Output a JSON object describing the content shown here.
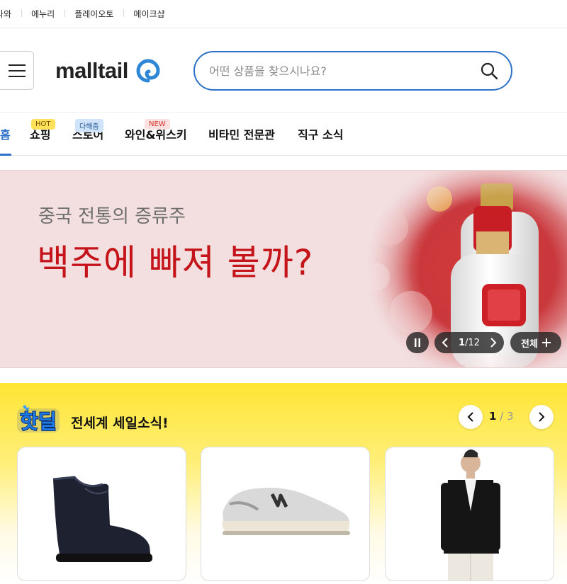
{
  "top_links": [
    "나와",
    "에누리",
    "플레이오토",
    "메이크샵"
  ],
  "logo": {
    "text": "malltail"
  },
  "search": {
    "placeholder": "어떤 상품을 찾으시나요?"
  },
  "nav": {
    "items": [
      {
        "label": "홈",
        "active": true
      },
      {
        "label": "쇼핑",
        "badge": "HOT"
      },
      {
        "label": "스토어",
        "badge": "다해줌"
      },
      {
        "label": "와인&위스키",
        "badge": "NEW"
      },
      {
        "label": "비타민 전문관"
      },
      {
        "label": "직구 소식"
      }
    ]
  },
  "banner": {
    "subtitle": "중국 전통의 증류주",
    "title": "백주에 빠져 볼까?",
    "page_current": "1",
    "page_total": "12",
    "all_label": "전체",
    "background_color": "#f3dfe0",
    "title_color": "#c4141a"
  },
  "hotdeal": {
    "logo_text": "핫딜",
    "title": "전세계 세일소식!",
    "page_current": "1",
    "page_total": "3",
    "products": [
      {
        "name": "rain-boot-image"
      },
      {
        "name": "sneaker-image"
      },
      {
        "name": "cardigan-model-image"
      }
    ]
  },
  "colors": {
    "accent": "#2d72c9",
    "hotdeal_yellow": "#ffe533"
  }
}
